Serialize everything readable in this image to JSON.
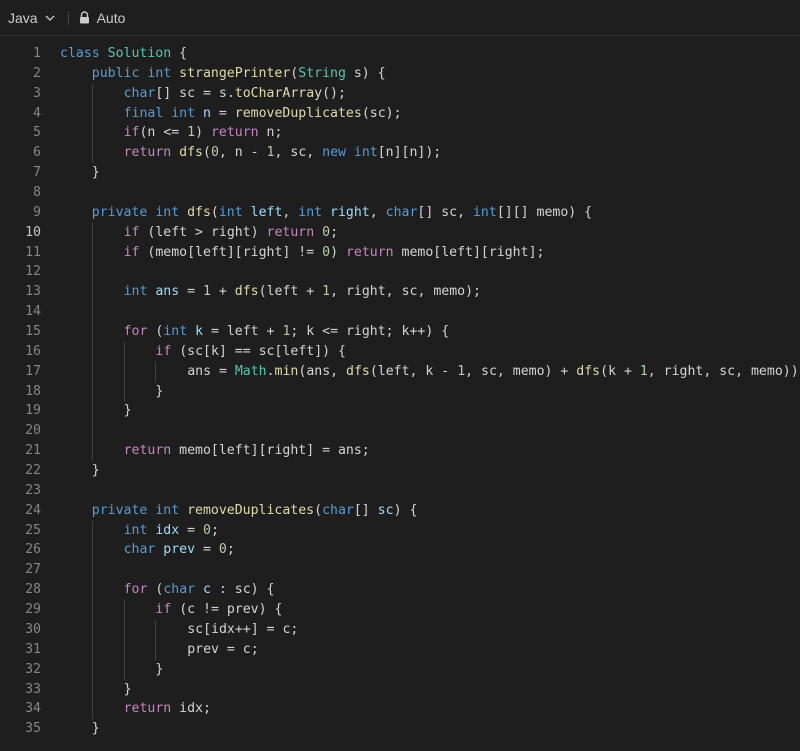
{
  "toolbar": {
    "language": "Java",
    "mode": "Auto"
  },
  "editor": {
    "active_line": 10,
    "lines": [
      {
        "n": "1",
        "indent": 0,
        "tokens": [
          [
            "kw",
            "class "
          ],
          [
            "ty",
            "Solution"
          ],
          [
            "op",
            " {"
          ]
        ]
      },
      {
        "n": "2",
        "indent": 1,
        "tokens": [
          [
            "kw",
            "public int "
          ],
          [
            "fn",
            "strangePrinter"
          ],
          [
            "op",
            "("
          ],
          [
            "ty",
            "String"
          ],
          [
            "op",
            " s) {"
          ]
        ]
      },
      {
        "n": "3",
        "indent": 2,
        "tokens": [
          [
            "kw",
            "char"
          ],
          [
            "op",
            "[] sc = s."
          ],
          [
            "fn",
            "toCharArray"
          ],
          [
            "op",
            "();"
          ]
        ]
      },
      {
        "n": "4",
        "indent": 2,
        "tokens": [
          [
            "kw",
            "final int "
          ],
          [
            "var",
            "n"
          ],
          [
            "op",
            " = "
          ],
          [
            "fn",
            "removeDuplicates"
          ],
          [
            "op",
            "(sc);"
          ]
        ]
      },
      {
        "n": "5",
        "indent": 2,
        "tokens": [
          [
            "ctl",
            "if"
          ],
          [
            "op",
            "(n <= "
          ],
          [
            "num",
            "1"
          ],
          [
            "op",
            ") "
          ],
          [
            "ctl",
            "return"
          ],
          [
            "op",
            " n;"
          ]
        ]
      },
      {
        "n": "6",
        "indent": 2,
        "tokens": [
          [
            "ctl",
            "return "
          ],
          [
            "fn",
            "dfs"
          ],
          [
            "op",
            "("
          ],
          [
            "num",
            "0"
          ],
          [
            "op",
            ", n - "
          ],
          [
            "num",
            "1"
          ],
          [
            "op",
            ", sc, "
          ],
          [
            "kw",
            "new int"
          ],
          [
            "op",
            "[n][n]);"
          ]
        ]
      },
      {
        "n": "7",
        "indent": 1,
        "tokens": [
          [
            "op",
            "}"
          ]
        ]
      },
      {
        "n": "8",
        "indent": 1,
        "tokens": []
      },
      {
        "n": "9",
        "indent": 1,
        "tokens": [
          [
            "kw",
            "private int "
          ],
          [
            "fn",
            "dfs"
          ],
          [
            "op",
            "("
          ],
          [
            "kw",
            "int "
          ],
          [
            "var",
            "left"
          ],
          [
            "op",
            ", "
          ],
          [
            "kw",
            "int "
          ],
          [
            "var",
            "right"
          ],
          [
            "op",
            ", "
          ],
          [
            "kw",
            "char"
          ],
          [
            "op",
            "[] sc, "
          ],
          [
            "kw",
            "int"
          ],
          [
            "op",
            "[][] memo) {"
          ]
        ]
      },
      {
        "n": "10",
        "indent": 2,
        "tokens": [
          [
            "ctl",
            "if"
          ],
          [
            "op",
            " (left > right) "
          ],
          [
            "ctl",
            "return "
          ],
          [
            "num",
            "0"
          ],
          [
            "op",
            ";"
          ]
        ]
      },
      {
        "n": "11",
        "indent": 2,
        "tokens": [
          [
            "ctl",
            "if"
          ],
          [
            "op",
            " (memo[left][right] != "
          ],
          [
            "num",
            "0"
          ],
          [
            "op",
            ") "
          ],
          [
            "ctl",
            "return"
          ],
          [
            "op",
            " memo[left][right];"
          ]
        ]
      },
      {
        "n": "12",
        "indent": 2,
        "tokens": []
      },
      {
        "n": "13",
        "indent": 2,
        "tokens": [
          [
            "kw",
            "int "
          ],
          [
            "var",
            "ans"
          ],
          [
            "op",
            " = "
          ],
          [
            "num",
            "1"
          ],
          [
            "op",
            " + "
          ],
          [
            "fn",
            "dfs"
          ],
          [
            "op",
            "(left + "
          ],
          [
            "num",
            "1"
          ],
          [
            "op",
            ", right, sc, memo);"
          ]
        ]
      },
      {
        "n": "14",
        "indent": 2,
        "tokens": []
      },
      {
        "n": "15",
        "indent": 2,
        "tokens": [
          [
            "ctl",
            "for"
          ],
          [
            "op",
            " ("
          ],
          [
            "kw",
            "int "
          ],
          [
            "var",
            "k"
          ],
          [
            "op",
            " = left + "
          ],
          [
            "num",
            "1"
          ],
          [
            "op",
            "; k <= right; k++) {"
          ]
        ]
      },
      {
        "n": "16",
        "indent": 3,
        "tokens": [
          [
            "ctl",
            "if"
          ],
          [
            "op",
            " (sc[k] == sc[left]) {"
          ]
        ]
      },
      {
        "n": "17",
        "indent": 4,
        "tokens": [
          [
            "op",
            "ans = "
          ],
          [
            "ty",
            "Math"
          ],
          [
            "op",
            "."
          ],
          [
            "fn",
            "min"
          ],
          [
            "op",
            "(ans, "
          ],
          [
            "fn",
            "dfs"
          ],
          [
            "op",
            "(left, k - "
          ],
          [
            "num",
            "1"
          ],
          [
            "op",
            ", sc, memo) + "
          ],
          [
            "fn",
            "dfs"
          ],
          [
            "op",
            "(k + "
          ],
          [
            "num",
            "1"
          ],
          [
            "op",
            ", right, sc, memo));"
          ]
        ]
      },
      {
        "n": "18",
        "indent": 3,
        "tokens": [
          [
            "op",
            "}"
          ]
        ]
      },
      {
        "n": "19",
        "indent": 2,
        "tokens": [
          [
            "op",
            "}"
          ]
        ]
      },
      {
        "n": "20",
        "indent": 2,
        "tokens": []
      },
      {
        "n": "21",
        "indent": 2,
        "tokens": [
          [
            "ctl",
            "return"
          ],
          [
            "op",
            " memo[left][right] = ans;"
          ]
        ]
      },
      {
        "n": "22",
        "indent": 1,
        "tokens": [
          [
            "op",
            "}"
          ]
        ]
      },
      {
        "n": "23",
        "indent": 1,
        "tokens": []
      },
      {
        "n": "24",
        "indent": 1,
        "tokens": [
          [
            "kw",
            "private int "
          ],
          [
            "fn",
            "removeDuplicates"
          ],
          [
            "op",
            "("
          ],
          [
            "kw",
            "char"
          ],
          [
            "op",
            "[] "
          ],
          [
            "var",
            "sc"
          ],
          [
            "op",
            ") {"
          ]
        ]
      },
      {
        "n": "25",
        "indent": 2,
        "tokens": [
          [
            "kw",
            "int "
          ],
          [
            "var",
            "idx"
          ],
          [
            "op",
            " = "
          ],
          [
            "num",
            "0"
          ],
          [
            "op",
            ";"
          ]
        ]
      },
      {
        "n": "26",
        "indent": 2,
        "tokens": [
          [
            "kw",
            "char "
          ],
          [
            "var",
            "prev"
          ],
          [
            "op",
            " = "
          ],
          [
            "num",
            "0"
          ],
          [
            "op",
            ";"
          ]
        ]
      },
      {
        "n": "27",
        "indent": 2,
        "tokens": []
      },
      {
        "n": "28",
        "indent": 2,
        "tokens": [
          [
            "ctl",
            "for"
          ],
          [
            "op",
            " ("
          ],
          [
            "kw",
            "char "
          ],
          [
            "var",
            "c"
          ],
          [
            "op",
            " : sc) {"
          ]
        ]
      },
      {
        "n": "29",
        "indent": 3,
        "tokens": [
          [
            "ctl",
            "if"
          ],
          [
            "op",
            " (c != prev) {"
          ]
        ]
      },
      {
        "n": "30",
        "indent": 4,
        "tokens": [
          [
            "op",
            "sc[idx++] = c;"
          ]
        ]
      },
      {
        "n": "31",
        "indent": 4,
        "tokens": [
          [
            "op",
            "prev = c;"
          ]
        ]
      },
      {
        "n": "32",
        "indent": 3,
        "tokens": [
          [
            "op",
            "}"
          ]
        ]
      },
      {
        "n": "33",
        "indent": 2,
        "tokens": [
          [
            "op",
            "}"
          ]
        ]
      },
      {
        "n": "34",
        "indent": 2,
        "tokens": [
          [
            "ctl",
            "return"
          ],
          [
            "op",
            " idx;"
          ]
        ]
      },
      {
        "n": "35",
        "indent": 1,
        "tokens": [
          [
            "op",
            "}"
          ]
        ]
      }
    ]
  }
}
